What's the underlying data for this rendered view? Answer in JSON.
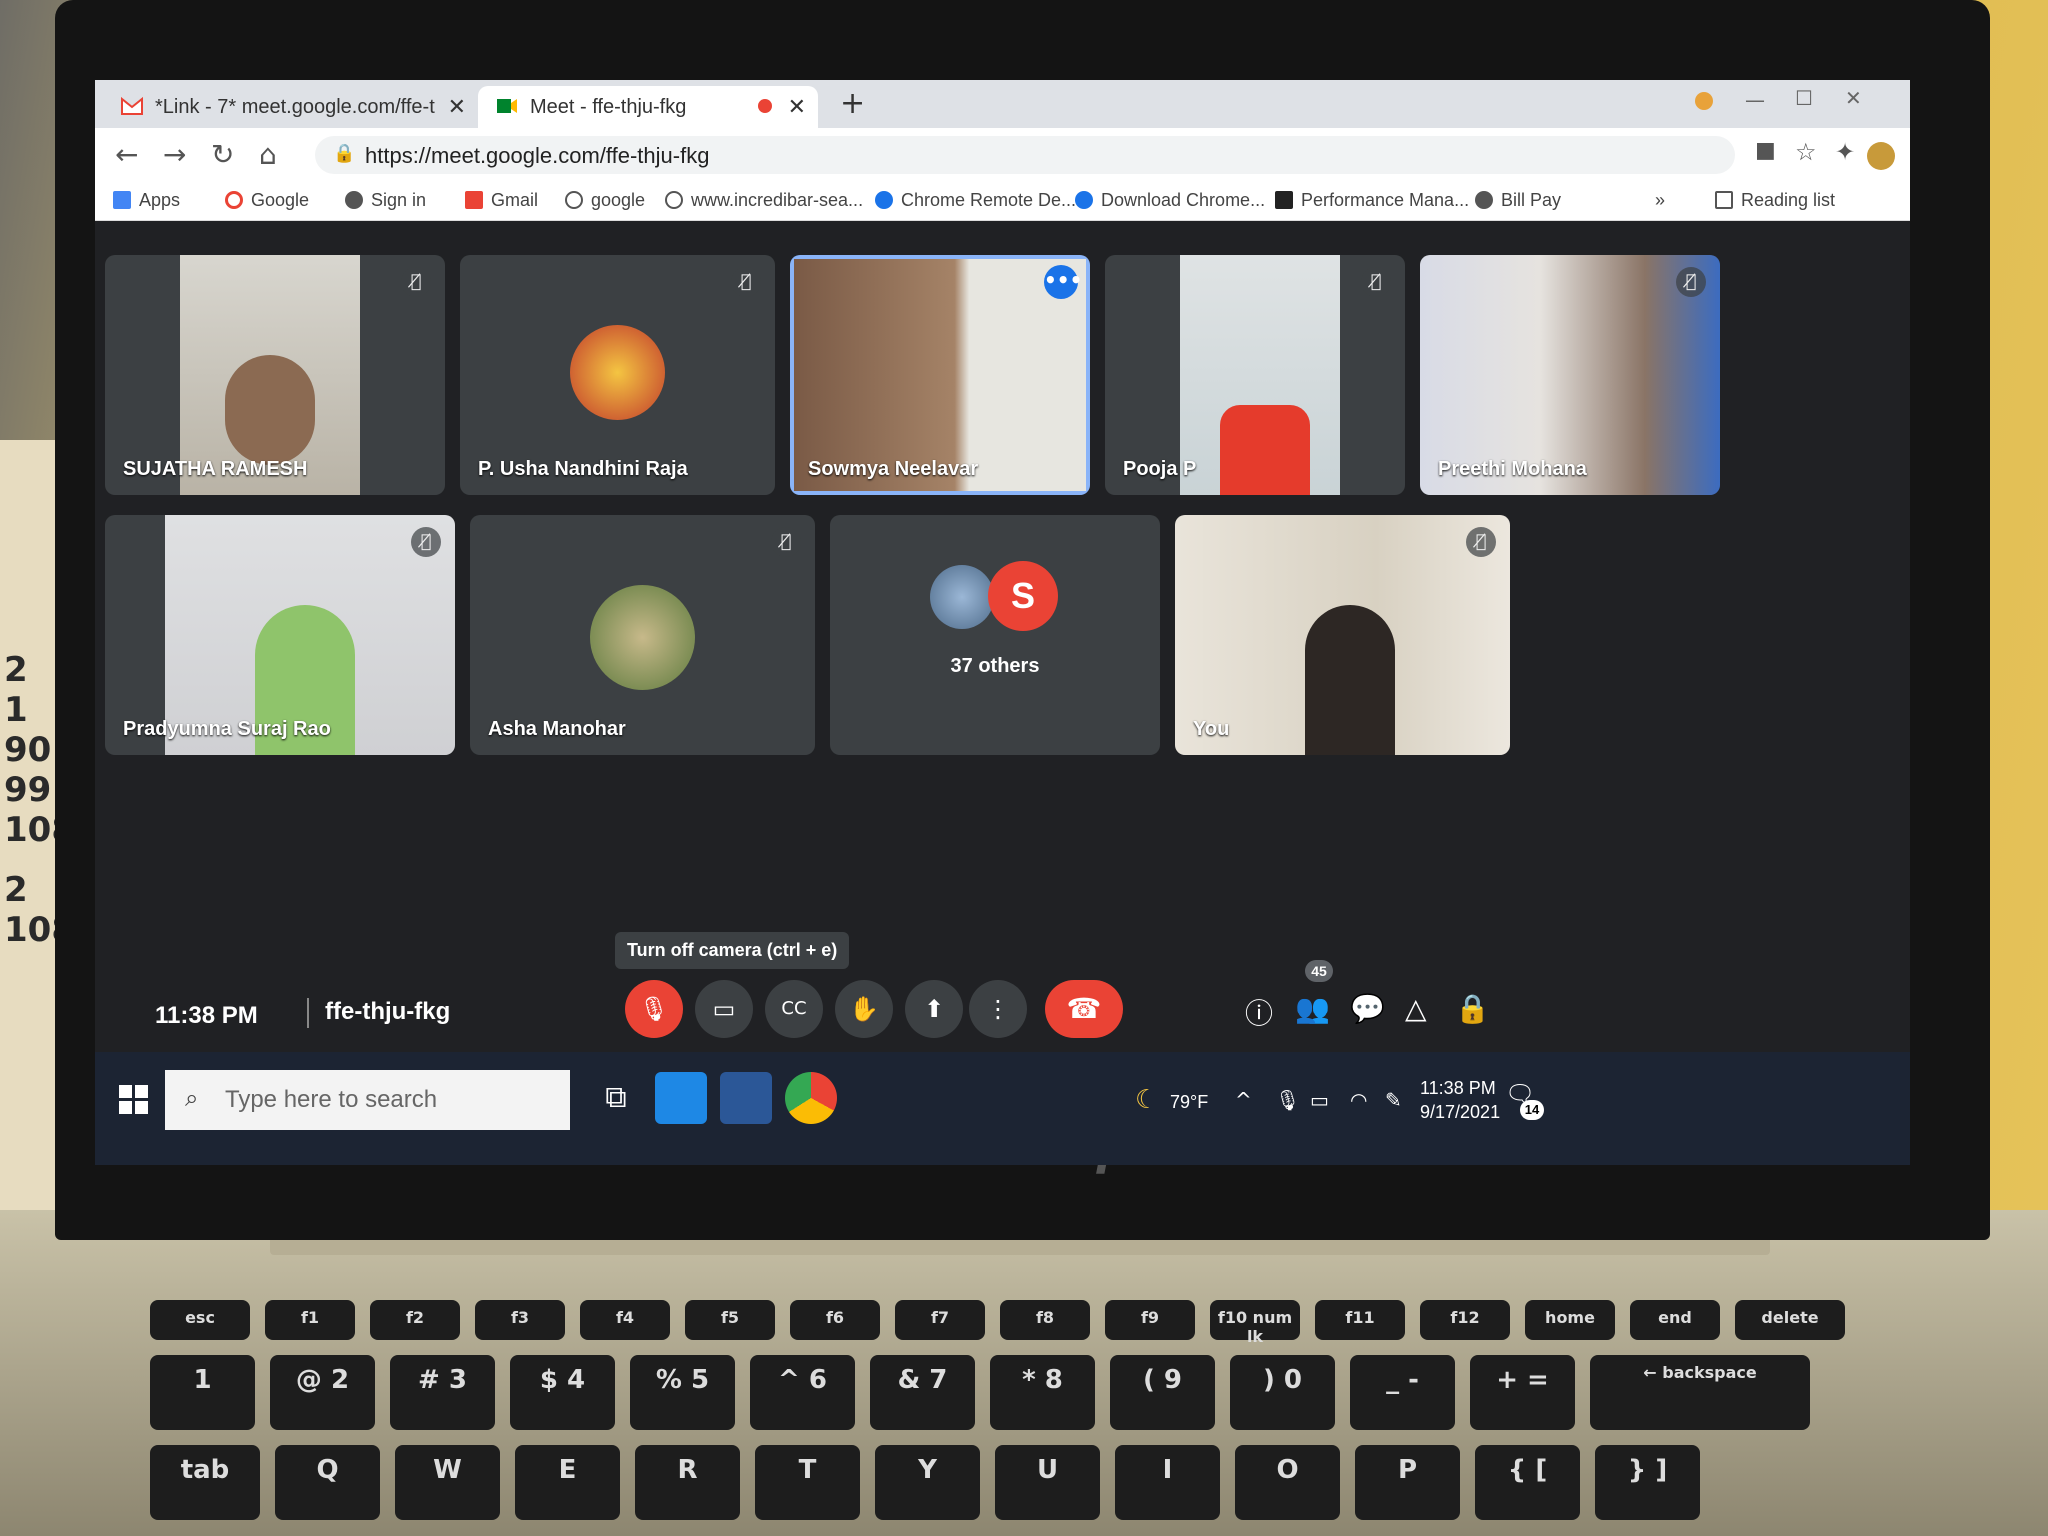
{
  "browser": {
    "tabs": [
      {
        "label": "*Link - 7* meet.google.com/ffe-t",
        "icon": "gmail-icon"
      },
      {
        "label": "Meet - ffe-thju-fkg",
        "icon": "meet-icon",
        "recording": true
      }
    ],
    "new_tab": "+",
    "url": "https://meet.google.com/ffe-thju-fkg",
    "bookmarks": [
      {
        "label": "Apps",
        "icon": "apps-grid-icon"
      },
      {
        "label": "Google",
        "icon": "google-icon"
      },
      {
        "label": "Sign in",
        "icon": "globe-icon"
      },
      {
        "label": "Gmail",
        "icon": "gmail-icon"
      },
      {
        "label": "google",
        "icon": "search-icon"
      },
      {
        "label": "www.incredibar-sea...",
        "icon": "search-icon"
      },
      {
        "label": "Chrome Remote De...",
        "icon": "remote-icon"
      },
      {
        "label": "Download Chrome...",
        "icon": "remote-icon"
      },
      {
        "label": "Performance Mana...",
        "icon": "d-icon"
      },
      {
        "label": "Bill Pay",
        "icon": "globe-icon"
      }
    ],
    "overflow": "»",
    "reading_list": "Reading list"
  },
  "meet": {
    "participants": [
      {
        "name": "SUJATHA RAMESH",
        "muted": true
      },
      {
        "name": "P. Usha Nandhini Raja",
        "muted": true
      },
      {
        "name": "Sowmya Neelavar",
        "speaking": true
      },
      {
        "name": "Pooja P",
        "muted": true
      },
      {
        "name": "Preethi Mohana",
        "muted": true
      },
      {
        "name": "Pradyumna Suraj Rao",
        "muted": true
      },
      {
        "name": "Asha Manohar",
        "muted": true
      },
      {
        "name": "37 others",
        "avatar_letter": "S"
      },
      {
        "name": "You",
        "muted": true
      }
    ],
    "time": "11:38 PM",
    "code": "ffe-thju-fkg",
    "tooltip": "Turn off camera (ctrl + e)",
    "people_count": "45",
    "colors": {
      "red": "#ea4335",
      "blue": "#1a73e8",
      "tile": "#3c4043",
      "bg": "#202124"
    }
  },
  "taskbar": {
    "search_placeholder": "Type here to search",
    "weather": "79°F",
    "clock_time": "11:38 PM",
    "clock_date": "9/17/2021",
    "notifications": "14"
  },
  "keyboard": {
    "top_row": [
      "esc",
      "f1",
      "f2",
      "f3",
      "f4",
      "f5",
      "f6",
      "f7",
      "f8",
      "f9",
      "f10 num lk",
      "f11",
      "f12",
      "home",
      "end",
      "delete"
    ],
    "num_row": [
      "1",
      "@ 2",
      "# 3",
      "$ 4",
      "% 5",
      "^ 6",
      "& 7",
      "* 8",
      "( 9",
      ") 0",
      "_ -",
      "+ =",
      "← backspace"
    ],
    "letters": [
      "tab",
      "Q",
      "W",
      "E",
      "R",
      "T",
      "Y",
      "U",
      "I",
      "O",
      "P",
      "{ [",
      "} ]"
    ]
  },
  "paper_numbers": [
    "2",
    "1",
    "90",
    "99",
    "108",
    "2",
    "108"
  ]
}
